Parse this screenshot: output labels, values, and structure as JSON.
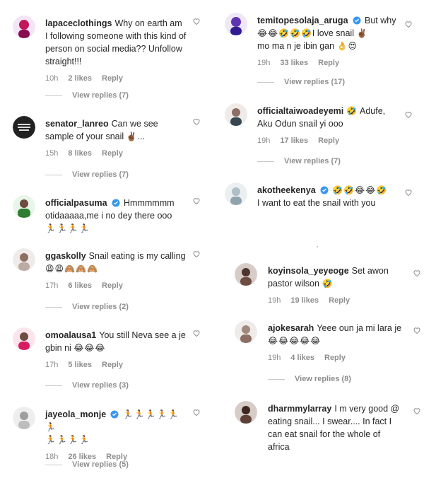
{
  "comments_left": [
    {
      "user": "lapaceclothings",
      "verified": false,
      "text": "Why on earth am I following someone with this kind of person on social media?? Unfollow straight!!!",
      "emojis": [],
      "time": "10h",
      "likes": "2 likes",
      "reply": "Reply",
      "view_replies": "View replies (7)",
      "avatar_color": "#c2185b"
    },
    {
      "user": "senator_lanreo",
      "verified": false,
      "text": "Can we see sample of your snail",
      "emojis": [
        "✌🏾",
        "..."
      ],
      "time": "15h",
      "likes": "8 likes",
      "reply": "Reply",
      "view_replies": "View replies (7)",
      "avatar_color": "#222222"
    },
    {
      "user": "officialpasuma",
      "verified": true,
      "text": "Hmmmmmm otidaaaaa,me i no dey there ooo",
      "emojis": [
        "🏃",
        "🏃",
        "🏃",
        "🏃"
      ],
      "time": "",
      "likes": "",
      "reply": "",
      "view_replies": "",
      "avatar_color": "#2e7d32"
    },
    {
      "user": "ggaskolly",
      "verified": false,
      "text": "Snail eating is my calling",
      "emojis": [
        "😩",
        "😩",
        "🙈",
        "🙈",
        "🙈"
      ],
      "time": "17h",
      "likes": "6 likes",
      "reply": "Reply",
      "view_replies": "View replies (2)",
      "avatar_color": "#8d6e63"
    },
    {
      "user": "omoalausa1",
      "verified": false,
      "text": "You still Neva see a je gbin ni",
      "emojis": [
        "😂",
        "😂",
        "😂"
      ],
      "time": "17h",
      "likes": "5 likes",
      "reply": "Reply",
      "view_replies": "View replies (3)",
      "avatar_color": "#6d4c41"
    },
    {
      "user": "jayeola_monje",
      "verified": true,
      "text": "",
      "emojis": [
        "🏃",
        "🏃",
        "🏃",
        "🏃",
        "🏃",
        "🏃",
        "🏃",
        "🏃",
        "🏃",
        "🏃"
      ],
      "time": "18h",
      "likes": "26 likes",
      "reply": "Reply",
      "view_replies": "View replies (5)",
      "avatar_color": "#9e9e9e"
    }
  ],
  "comments_right": [
    {
      "user": "temitopesolaja_aruga",
      "verified": true,
      "text": "But why",
      "text2": "I love snail",
      "text3": "mo ma n je ibin gan",
      "emojis": [
        "😂",
        "😂",
        "🤣",
        "🤣",
        "🤣"
      ],
      "emojis2": [
        "✌🏾"
      ],
      "emojis3": [
        "👌",
        "😍"
      ],
      "time": "19h",
      "likes": "33 likes",
      "reply": "Reply",
      "view_replies": "View replies (17)",
      "avatar_color": "#5e35b1"
    },
    {
      "user": "officialtaiwoadeyemi",
      "verified": false,
      "text": "Adufe, Aku Odun snail yi ooo",
      "emojis": [
        "🤣"
      ],
      "time": "19h",
      "likes": "17 likes",
      "reply": "Reply",
      "view_replies": "View replies (7)",
      "avatar_color": "#8d6e63"
    },
    {
      "user": "akotheekenya",
      "verified": true,
      "text": "I want to eat the snail with you",
      "emojis": [
        "🤣",
        "🤣",
        "😂",
        "😂",
        "🤣"
      ],
      "time": "",
      "likes": "",
      "reply": "",
      "view_replies": "",
      "avatar_color": "#b0bec5"
    },
    {
      "user": "koyinsola_yeyeoge",
      "verified": false,
      "text": "Set awon pastor wilson",
      "emojis": [
        "🤣"
      ],
      "time": "19h",
      "likes": "19 likes",
      "reply": "Reply",
      "view_replies": "",
      "avatar_color": "#4e342e"
    },
    {
      "user": "ajokesarah",
      "verified": false,
      "text": "Yeee oun ja mi lara je",
      "emojis": [
        "😂",
        "😂",
        "😂",
        "😂",
        "😂"
      ],
      "time": "19h",
      "likes": "4 likes",
      "reply": "Reply",
      "view_replies": "View replies (8)",
      "avatar_color": "#a1887f"
    },
    {
      "user": "dharmmylarray",
      "verified": false,
      "text": "I m very good @ eating snail... I swear.... In fact I can eat snail for the whole of africa",
      "emojis": [],
      "time": "",
      "likes": "",
      "reply": "",
      "view_replies": "",
      "avatar_color": "#3e2723"
    }
  ]
}
